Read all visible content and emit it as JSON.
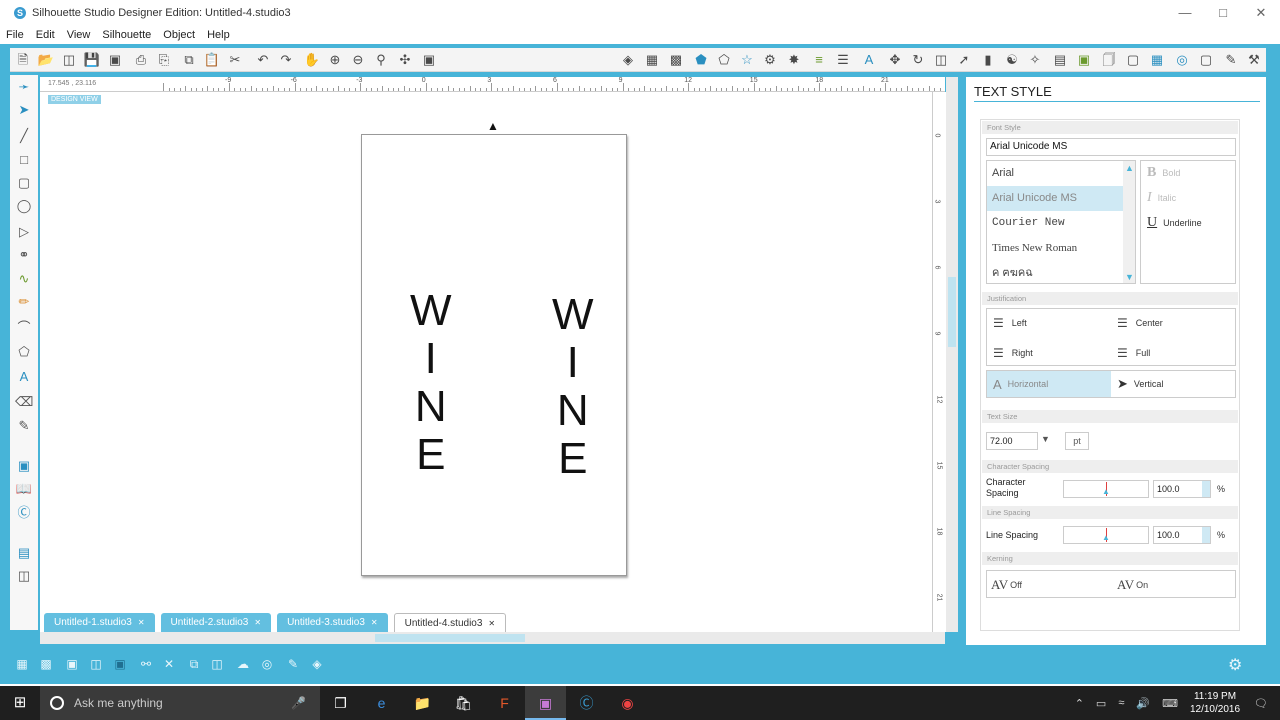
{
  "window": {
    "title": "Silhouette Studio Designer Edition: Untitled-4.studio3"
  },
  "menu": [
    "File",
    "Edit",
    "View",
    "Silhouette",
    "Object",
    "Help"
  ],
  "canvas": {
    "coords": "17.545 , 23.116",
    "design_view": "DESIGN VIEW",
    "ruler_top_labels": [
      "-9",
      "-6",
      "-3",
      "0",
      "3",
      "6",
      "9",
      "12",
      "15",
      "18",
      "21",
      "24"
    ],
    "ruler_right_labels": [
      "0",
      "3",
      "6",
      "9",
      "12",
      "15",
      "18",
      "21"
    ],
    "letters_left": [
      "W",
      "I",
      "N",
      "E"
    ],
    "letters_right": [
      "W",
      "I",
      "N",
      "E"
    ]
  },
  "tabs": [
    {
      "label": "Untitled-1.studio3",
      "active": false
    },
    {
      "label": "Untitled-2.studio3",
      "active": false
    },
    {
      "label": "Untitled-3.studio3",
      "active": false
    },
    {
      "label": "Untitled-4.studio3",
      "active": true
    }
  ],
  "text_style": {
    "title": "TEXT STYLE",
    "font_style_label": "Font Style",
    "font_value": "Arial Unicode MS",
    "fonts": [
      "Arial",
      "Arial Unicode MS",
      "Courier New",
      "Times New Roman",
      "ค ฅฆคฉ"
    ],
    "styles": {
      "bold": "Bold",
      "italic": "Italic",
      "underline": "Underline"
    },
    "justification_label": "Justification",
    "justify": {
      "left": "Left",
      "center": "Center",
      "right": "Right",
      "full": "Full"
    },
    "orientation": {
      "horizontal": "Horizontal",
      "vertical": "Vertical"
    },
    "text_size_label": "Text Size",
    "text_size": "72.00",
    "unit": "pt",
    "char_spacing_label": "Character Spacing",
    "char_spacing_row": "Character Spacing",
    "char_spacing_value": "100.0",
    "line_spacing_label": "Line Spacing",
    "line_spacing_row": "Line Spacing",
    "line_spacing_value": "100.0",
    "percent": "%",
    "kerning_label": "Kerning",
    "kern_off": "Off",
    "kern_on": "On"
  },
  "taskbar": {
    "search_placeholder": "Ask me anything",
    "time": "11:19 PM",
    "date": "12/10/2016"
  }
}
